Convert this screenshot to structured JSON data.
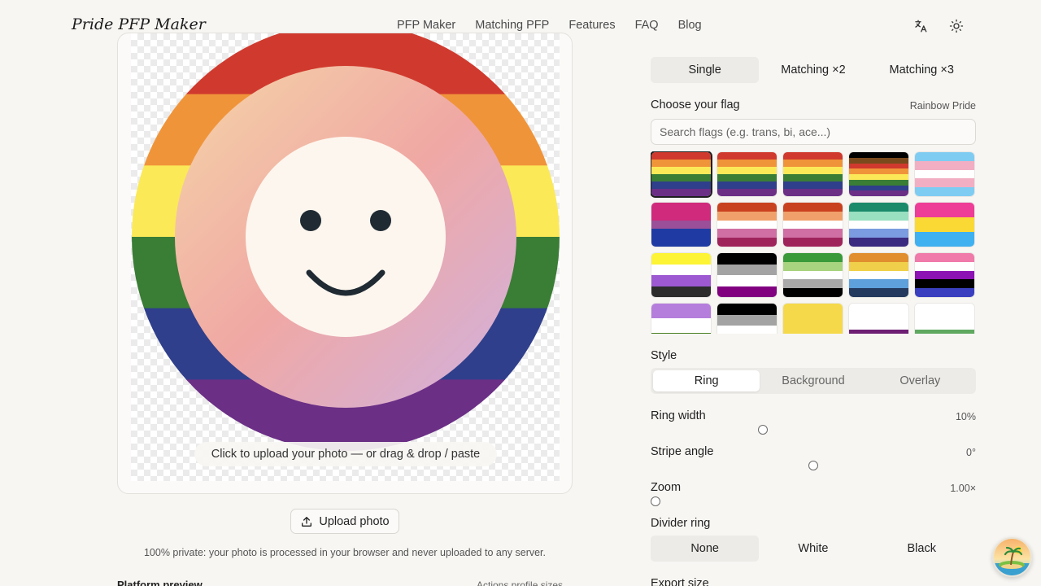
{
  "header": {
    "logo": "Pride PFP Maker",
    "nav": [
      "PFP Maker",
      "Matching PFP",
      "Features",
      "FAQ",
      "Blog"
    ],
    "icons": [
      "translate-icon",
      "sun-icon"
    ]
  },
  "preview": {
    "upload_hint": "Click to upload your photo — or drag & drop / paste",
    "ring_colors": [
      "#d03a2e",
      "#f0943a",
      "#fbe958",
      "#3a7d35",
      "#2f3f8b",
      "#6b2f86"
    ],
    "placeholder_gradient": [
      "#f5d5a8",
      "#f0a8a4",
      "#cfb1e0"
    ],
    "face_color": "#fdf6ee",
    "feature_color": "#1f2a33"
  },
  "upload_button": "Upload photo",
  "privacy_note": "100% private: your photo is processed in your browser and never uploaded to any server.",
  "cutoff": {
    "left": "Platform preview",
    "right": "Actions profile sizes"
  },
  "mode": {
    "options": [
      "Single",
      "Matching ×2",
      "Matching ×3"
    ],
    "active": 0
  },
  "flags": {
    "label": "Choose your flag",
    "selected_name": "Rainbow Pride",
    "search_placeholder": "Search flags (e.g. trans, bi, ace...)",
    "selected_index": 0,
    "items": [
      [
        "#d03a2e",
        "#f0943a",
        "#fbe958",
        "#3a7d35",
        "#2f3f8b",
        "#6b2f86"
      ],
      [
        "#d03a2e",
        "#f0943a",
        "#fbe958",
        "#3a7d35",
        "#2f3f8b",
        "#6b2f86"
      ],
      [
        "#d03a2e",
        "#f0943a",
        "#fbe958",
        "#3a7d35",
        "#2f3f8b",
        "#6b2f86"
      ],
      [
        "#000000",
        "#7a4a1c",
        "#d03a2e",
        "#f0943a",
        "#fbe958",
        "#3a7d35",
        "#2f3f8b",
        "#6b2f86"
      ],
      [
        "#7fccf2",
        "#f2afc3",
        "#ffffff",
        "#f2afc3",
        "#7fccf2"
      ],
      [
        "#cf2a7b",
        "#cf2a7b",
        "#9b4f98",
        "#1f3aa3",
        "#1f3aa3"
      ],
      [
        "#c9421f",
        "#f0a06a",
        "#ffffff",
        "#cf6fa3",
        "#a0245c"
      ],
      [
        "#c9421f",
        "#f0a06a",
        "#ffffff",
        "#cf6fa3",
        "#a0245c"
      ],
      [
        "#1b8a6b",
        "#98e0c0",
        "#ffffff",
        "#7b9ce0",
        "#3a2a80"
      ],
      [
        "#ee3d96",
        "#fbd934",
        "#3fb0f0"
      ],
      [
        "#fcf434",
        "#ffffff",
        "#9c59d1",
        "#2c2c2c"
      ],
      [
        "#000000",
        "#a3a3a3",
        "#ffffff",
        "#800080"
      ],
      [
        "#3a9a3a",
        "#a8d37f",
        "#ffffff",
        "#a9a9a9",
        "#000000"
      ],
      [
        "#e08e2e",
        "#f0d04a",
        "#ffffff",
        "#5da0dc",
        "#243a5e"
      ],
      [
        "#f07aa9",
        "#ffffff",
        "#8c12b4",
        "#000000",
        "#3a3fbf"
      ],
      [
        "#b57edc",
        "#ffffff",
        "#4a8123"
      ],
      [
        "#000000",
        "#a3a3a3",
        "#ffffff",
        "#b8f483"
      ],
      [
        "#f5d94a"
      ],
      [
        "#ffffff",
        "#ffffff",
        "#ffffff",
        "#6e1f74",
        "#dcdcdc"
      ],
      [
        "#ffffff",
        "#ffffff",
        "#ffffff",
        "#5fa85f",
        "#cfcfcf"
      ]
    ]
  },
  "style": {
    "label": "Style",
    "options": [
      "Ring",
      "Background",
      "Overlay"
    ],
    "active": 0
  },
  "sliders": [
    {
      "label": "Ring width",
      "value": "10%",
      "pos": 0.34
    },
    {
      "label": "Stripe angle",
      "value": "0°",
      "pos": 0.5
    },
    {
      "label": "Zoom",
      "value": "1.00×",
      "pos": 0.0
    }
  ],
  "divider": {
    "label": "Divider ring",
    "options": [
      "None",
      "White",
      "Black"
    ],
    "active": 0
  },
  "export_label": "Export size"
}
